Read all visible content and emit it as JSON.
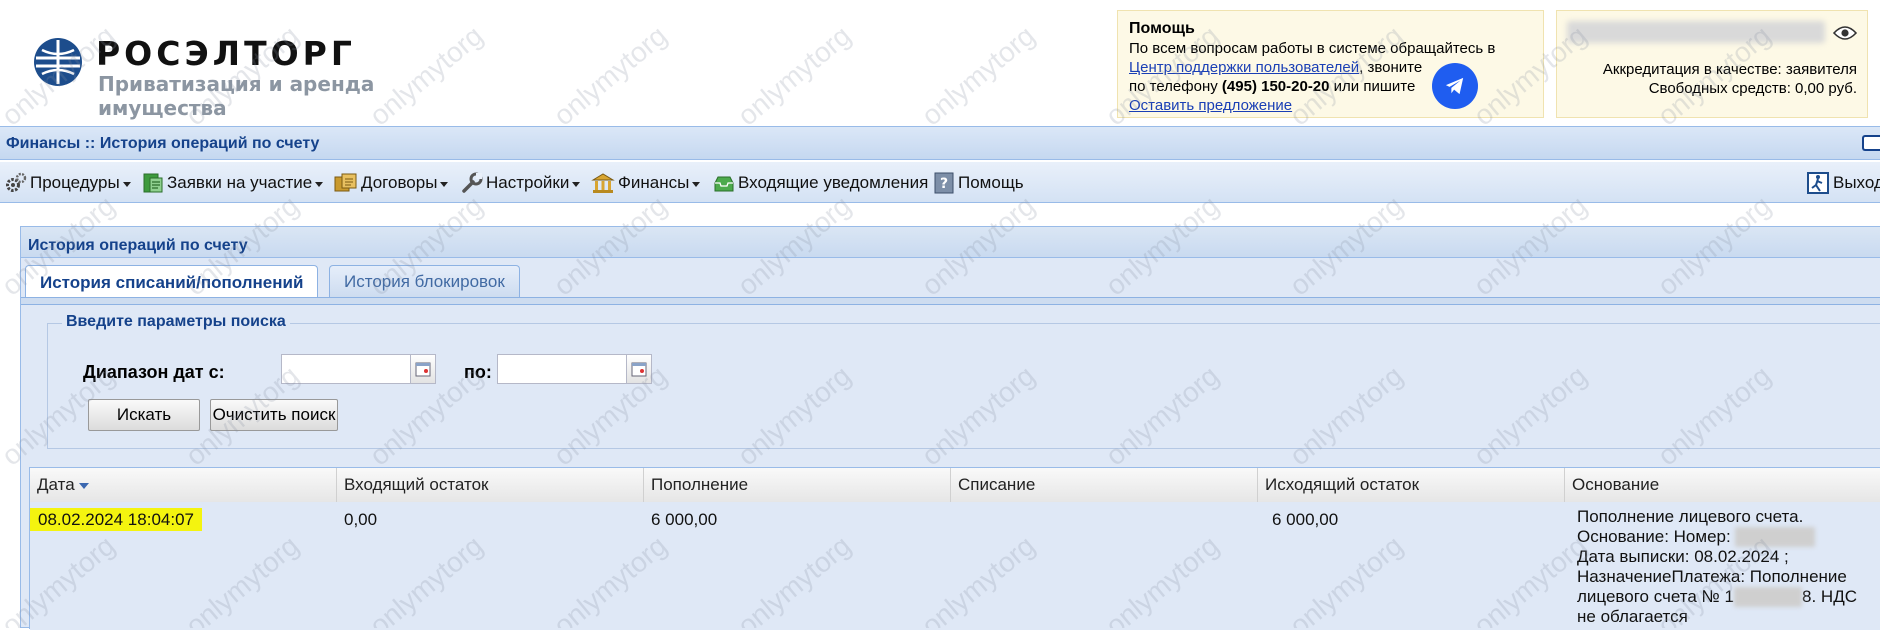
{
  "header": {
    "brand": "РОСЭЛТОРГ",
    "subtitle": "Приватизация и аренда имущества",
    "help": {
      "title": "Помощь",
      "line1": "По всем вопросам работы в системе обращайтесь в",
      "support_link": "Центр поддержки пользователей",
      "line2_suffix": ", звоните",
      "line3_prefix": "по телефону ",
      "phone": "(495) 150-20-20",
      "line3_suffix": " или пишите",
      "suggest_link": "Оставить предложение"
    },
    "account": {
      "accreditation": "Аккредитация в качестве: заявителя",
      "funds": "Свободных средств: 0,00 руб."
    }
  },
  "titlebar": {
    "title": "Финансы :: История операций по счету"
  },
  "menu": {
    "procedures": "Процедуры",
    "applications": "Заявки на участие",
    "contracts": "Договоры",
    "settings": "Настройки",
    "finance": "Финансы",
    "notifications": "Входящие уведомления",
    "help": "Помощь",
    "exit": "Выход"
  },
  "panel": {
    "title": "История операций по счету",
    "tabs": [
      "История списаний/пополнений",
      "История блокировок"
    ],
    "search": {
      "legend": "Введите параметры поиска",
      "date_from_label": "Диапазон дат с:",
      "date_to_label": "по:",
      "date_from_value": "",
      "date_to_value": "",
      "search_button": "Искать",
      "clear_button": "Очистить поиск"
    },
    "grid": {
      "columns": [
        "Дата",
        "Входящий остаток",
        "Пополнение",
        "Списание",
        "Исходящий остаток",
        "Основание"
      ],
      "rows": [
        {
          "date": "08.02.2024 18:04:07",
          "incoming": "0,00",
          "deposit": "6 000,00",
          "writeoff": "",
          "outgoing": "6 000,00",
          "reason_1": "Пополнение лицевого счета. Основание: Номер:",
          "reason_2": "Дата выписки: 08.02.2024 ; НазначениеПлатежа: Пополнение лицевого счета № 1",
          "reason_3": "8. НДС не облагается"
        }
      ]
    }
  },
  "watermark": "onlymytorg",
  "colors": {
    "accent": "#15428b",
    "highlight": "#f4f40f",
    "telegram": "#1f5df0"
  }
}
